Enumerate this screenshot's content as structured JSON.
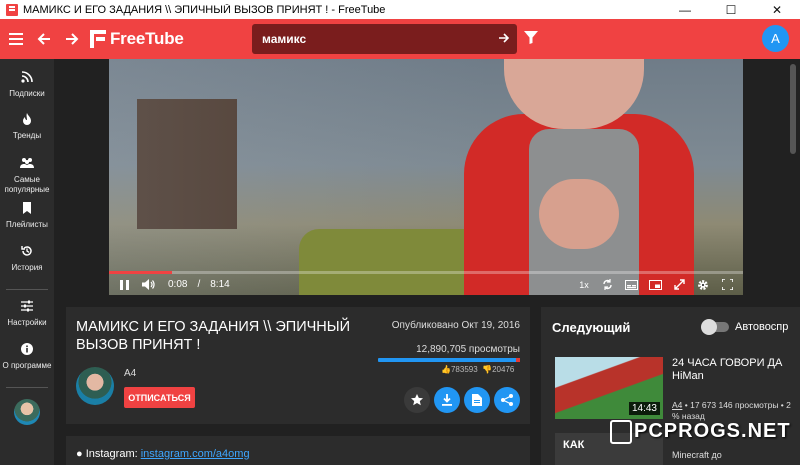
{
  "window": {
    "title": "МАМИКС И ЕГО ЗАДАНИЯ \\\\ ЭПИЧНЫЙ ВЫЗОВ ПРИНЯТ ! - FreeTube",
    "minimize": "—",
    "maximize": "☐",
    "close": "✕"
  },
  "topnav": {
    "app_name": "FreeTube",
    "search_value": "мамикс",
    "avatar_letter": "A",
    "accent": "#f04242"
  },
  "sidebar": {
    "items": [
      {
        "label": "Подписки",
        "icon": "rss-icon"
      },
      {
        "label": "Тренды",
        "icon": "flame-icon"
      },
      {
        "label": "Самые популярные",
        "icon": "users-icon"
      },
      {
        "label": "Плейлисты",
        "icon": "bookmark-icon"
      },
      {
        "label": "История",
        "icon": "history-icon"
      },
      {
        "label": "Настройки",
        "icon": "sliders-icon"
      },
      {
        "label": "О программе",
        "icon": "info-icon"
      }
    ]
  },
  "player": {
    "current_time": "0:08",
    "separator": "/",
    "duration": "8:14",
    "speed": "1x",
    "progress_fraction": 0.016
  },
  "video": {
    "title": "МАМИКС И ЕГО ЗАДАНИЯ \\\\ ЭПИЧНЫЙ ВЫЗОВ ПРИНЯТ !",
    "published": "Опубликовано Окт 19, 2016",
    "views": "12,890,705 просмотры",
    "likes": "783593",
    "dislikes": "20476",
    "like_ratio": 0.975,
    "channel": "A4",
    "subscribe_label": "ОТПИСАТЬСЯ"
  },
  "description": {
    "prefix": "● Instagram: ",
    "link": "instagram.com/a4omg"
  },
  "recommendations": {
    "heading": "Следующий",
    "autoplay_label": "Автовоспр",
    "items": [
      {
        "title": "24 ЧАСА ГОВОРИ ДА HiMan",
        "channel": "A4",
        "meta": " • 17 673 146 просмотры • 2 % назад",
        "duration": "14:43"
      },
      {
        "title": "Minecraft до",
        "thumb_text": "КАК"
      }
    ]
  },
  "watermark": "PCPROGS.NET"
}
